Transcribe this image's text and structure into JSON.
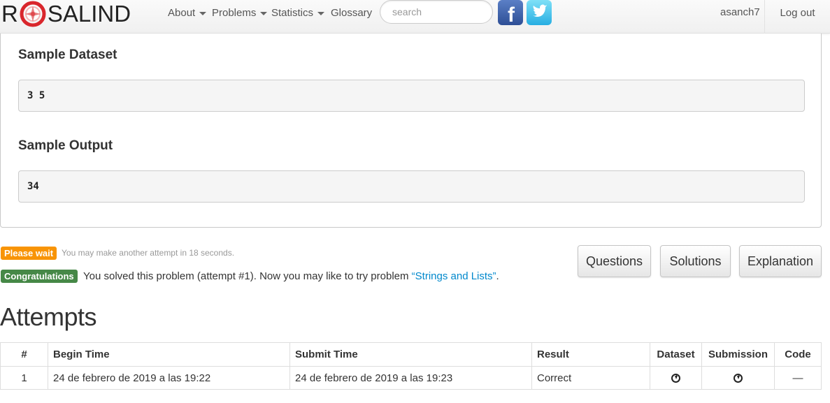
{
  "brand": {
    "left": "R",
    "right": "SALIND"
  },
  "nav": {
    "about": "About",
    "problems": "Problems",
    "statistics": "Statistics",
    "glossary": "Glossary"
  },
  "search": {
    "placeholder": "search"
  },
  "social": {
    "facebook": "f"
  },
  "user": {
    "name": "asanch7",
    "logout": "Log out"
  },
  "sample": {
    "dataset_heading": "Sample Dataset",
    "dataset_value": "3 5",
    "output_heading": "Sample Output",
    "output_value": "34"
  },
  "status": {
    "wait_label": "Please wait",
    "wait_text": "You may make another attempt in 18 seconds.",
    "ok_label": "Congratulations",
    "ok_text": "You solved this problem (attempt #1). Now you may like to try problem ",
    "next_problem": "“Strings and Lists”",
    "ok_suffix": "."
  },
  "buttons": {
    "questions": "Questions",
    "solutions": "Solutions",
    "explanation": "Explanation"
  },
  "attempts": {
    "heading": "Attempts",
    "headers": [
      "#",
      "Begin Time",
      "Submit Time",
      "Result",
      "Dataset",
      "Submission",
      "Code"
    ],
    "rows": [
      {
        "num": "1",
        "begin": "24 de febrero de 2019 a las 19:22",
        "submit": "24 de febrero de 2019 a las 19:23",
        "result": "Correct",
        "code": "—"
      }
    ]
  }
}
